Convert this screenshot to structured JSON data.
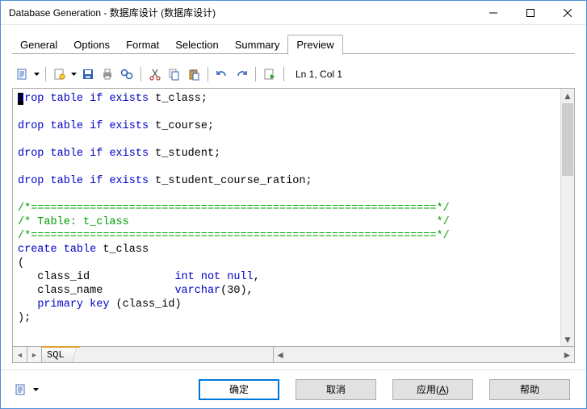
{
  "window": {
    "title": "Database Generation - 数据库设计 (数据库设计)"
  },
  "tabs": [
    {
      "label": "General",
      "active": false
    },
    {
      "label": "Options",
      "active": false
    },
    {
      "label": "Format",
      "active": false
    },
    {
      "label": "Selection",
      "active": false
    },
    {
      "label": "Summary",
      "active": false
    },
    {
      "label": "Preview",
      "active": true
    }
  ],
  "toolbar": {
    "status": "Ln 1, Col 1"
  },
  "code": {
    "tokens": [
      {
        "t": "caret"
      },
      {
        "t": "kw",
        "v": "drop"
      },
      {
        "t": "p",
        "v": " "
      },
      {
        "t": "kw",
        "v": "table"
      },
      {
        "t": "p",
        "v": " "
      },
      {
        "t": "kw",
        "v": "if"
      },
      {
        "t": "p",
        "v": " "
      },
      {
        "t": "kw",
        "v": "exists"
      },
      {
        "t": "p",
        "v": " t_class;"
      },
      {
        "t": "br"
      },
      {
        "t": "br"
      },
      {
        "t": "kw",
        "v": "drop"
      },
      {
        "t": "p",
        "v": " "
      },
      {
        "t": "kw",
        "v": "table"
      },
      {
        "t": "p",
        "v": " "
      },
      {
        "t": "kw",
        "v": "if"
      },
      {
        "t": "p",
        "v": " "
      },
      {
        "t": "kw",
        "v": "exists"
      },
      {
        "t": "p",
        "v": " t_course;"
      },
      {
        "t": "br"
      },
      {
        "t": "br"
      },
      {
        "t": "kw",
        "v": "drop"
      },
      {
        "t": "p",
        "v": " "
      },
      {
        "t": "kw",
        "v": "table"
      },
      {
        "t": "p",
        "v": " "
      },
      {
        "t": "kw",
        "v": "if"
      },
      {
        "t": "p",
        "v": " "
      },
      {
        "t": "kw",
        "v": "exists"
      },
      {
        "t": "p",
        "v": " t_student;"
      },
      {
        "t": "br"
      },
      {
        "t": "br"
      },
      {
        "t": "kw",
        "v": "drop"
      },
      {
        "t": "p",
        "v": " "
      },
      {
        "t": "kw",
        "v": "table"
      },
      {
        "t": "p",
        "v": " "
      },
      {
        "t": "kw",
        "v": "if"
      },
      {
        "t": "p",
        "v": " "
      },
      {
        "t": "kw",
        "v": "exists"
      },
      {
        "t": "p",
        "v": " t_student_course_ration;"
      },
      {
        "t": "br"
      },
      {
        "t": "br"
      },
      {
        "t": "cmt",
        "v": "/*==============================================================*/"
      },
      {
        "t": "br"
      },
      {
        "t": "cmt",
        "v": "/* Table: t_class                                               */"
      },
      {
        "t": "br"
      },
      {
        "t": "cmt",
        "v": "/*==============================================================*/"
      },
      {
        "t": "br"
      },
      {
        "t": "kw",
        "v": "create"
      },
      {
        "t": "p",
        "v": " "
      },
      {
        "t": "kw",
        "v": "table"
      },
      {
        "t": "p",
        "v": " t_class"
      },
      {
        "t": "br"
      },
      {
        "t": "p",
        "v": "("
      },
      {
        "t": "br"
      },
      {
        "t": "p",
        "v": "   class_id             "
      },
      {
        "t": "kw",
        "v": "int"
      },
      {
        "t": "p",
        "v": " "
      },
      {
        "t": "kw",
        "v": "not"
      },
      {
        "t": "p",
        "v": " "
      },
      {
        "t": "kw",
        "v": "null"
      },
      {
        "t": "p",
        "v": ","
      },
      {
        "t": "br"
      },
      {
        "t": "p",
        "v": "   class_name           "
      },
      {
        "t": "kw",
        "v": "varchar"
      },
      {
        "t": "p",
        "v": "(30),"
      },
      {
        "t": "br"
      },
      {
        "t": "p",
        "v": "   "
      },
      {
        "t": "kw",
        "v": "primary"
      },
      {
        "t": "p",
        "v": " "
      },
      {
        "t": "kw",
        "v": "key"
      },
      {
        "t": "p",
        "v": " (class_id)"
      },
      {
        "t": "br"
      },
      {
        "t": "p",
        "v": ");"
      }
    ]
  },
  "editorTab": {
    "label": "SQL"
  },
  "buttons": {
    "ok": "确定",
    "cancel": "取消",
    "apply": "应用(",
    "apply_u": "A",
    "apply_end": ")",
    "help": "帮助"
  }
}
